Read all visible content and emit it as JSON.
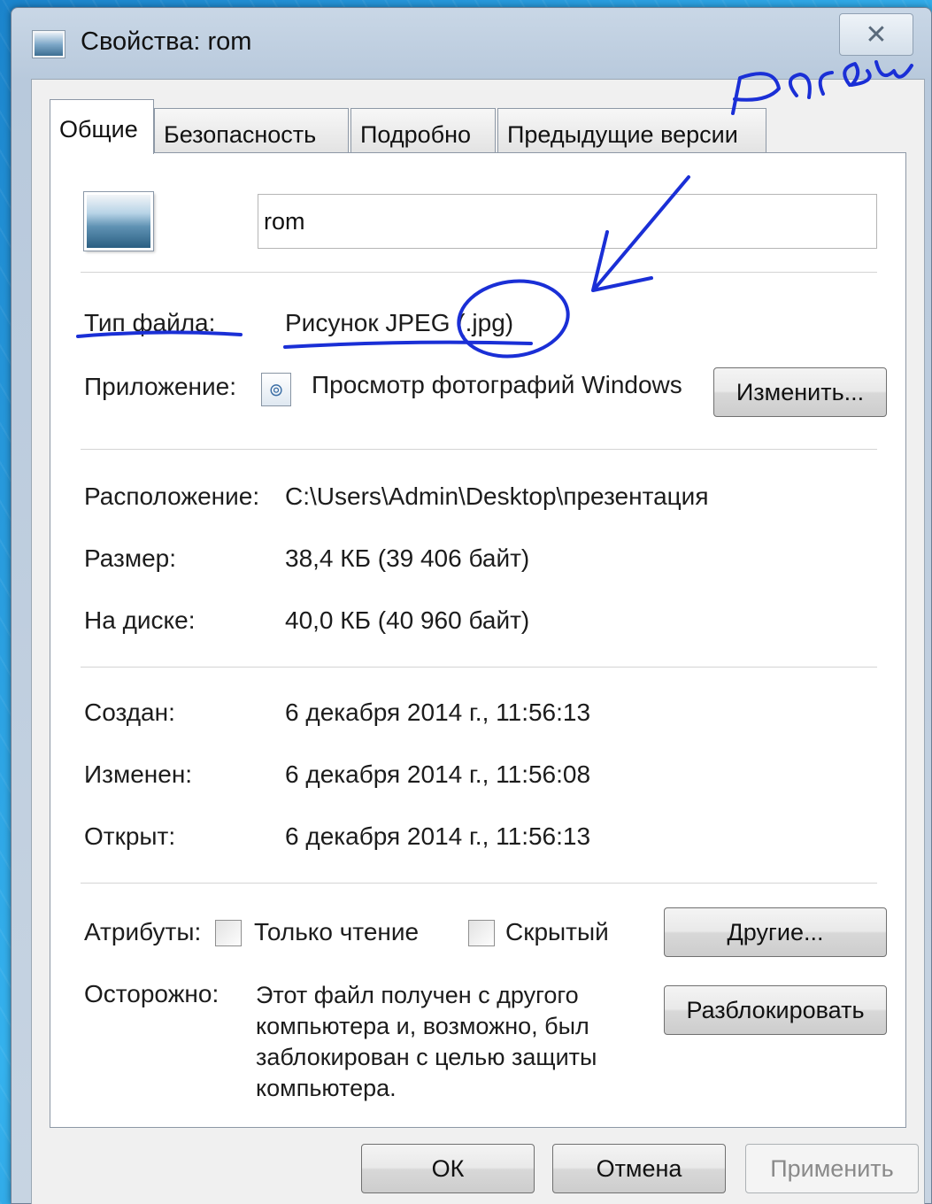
{
  "window": {
    "title": "Свойства: rom",
    "close_symbol": "✕"
  },
  "tabs": [
    {
      "label": "Общие",
      "active": true
    },
    {
      "label": "Безопасность",
      "active": false
    },
    {
      "label": "Подробно",
      "active": false
    },
    {
      "label": "Предыдущие версии",
      "active": false
    }
  ],
  "general": {
    "file_name": "rom",
    "file_type_label": "Тип файла:",
    "file_type_value": "Рисунок JPEG (.jpg)",
    "app_label": "Приложение:",
    "app_value": "Просмотр фотографий Windows",
    "change_button": "Изменить...",
    "location_label": "Расположение:",
    "location_value": "C:\\Users\\Admin\\Desktop\\презентация",
    "size_label": "Размер:",
    "size_value": "38,4 КБ (39 406 байт)",
    "disk_label": "На диске:",
    "disk_value": "40,0 КБ (40 960 байт)",
    "created_label": "Создан:",
    "created_value": "6 декабря 2014 г., 11:56:13",
    "modified_label": "Изменен:",
    "modified_value": "6 декабря 2014 г., 11:56:08",
    "opened_label": "Открыт:",
    "opened_value": "6 декабря 2014 г., 11:56:13",
    "attributes_label": "Атрибуты:",
    "readonly_label": "Только чтение",
    "readonly_checked": false,
    "hidden_label": "Скрытый",
    "hidden_checked": false,
    "other_button": "Другие...",
    "warning_label": "Осторожно:",
    "warning_text": "Этот файл получен с другого компьютера и, возможно, был заблокирован с целью защиты компьютера.",
    "unblock_button": "Разблокировать"
  },
  "footer": {
    "ok": "ОК",
    "cancel": "Отмена",
    "apply": "Применить"
  },
  "annotation": {
    "handwritten_text": "Расш",
    "ink_color": "#1a2fd6"
  }
}
